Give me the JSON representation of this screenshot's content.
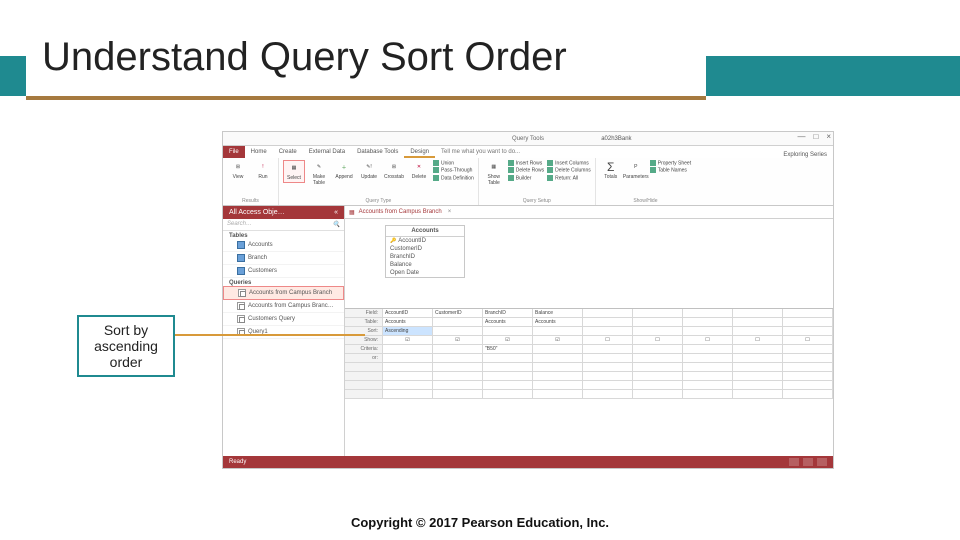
{
  "slide": {
    "title": "Understand Query Sort Order",
    "callout": "Sort by ascending order",
    "copyright": "Copyright © 2017 Pearson Education, Inc."
  },
  "window": {
    "context_label": "Query Tools",
    "filename": "a02h3Bank",
    "signin": "Exploring Series",
    "controls": {
      "min": "—",
      "max": "□",
      "close": "×"
    }
  },
  "ribbon_tabs": [
    "File",
    "Home",
    "Create",
    "External Data",
    "Database Tools",
    "Design",
    "Tell me what you want to do..."
  ],
  "ribbon": {
    "groups": [
      {
        "name": "Results",
        "buttons": [
          "View",
          "Run"
        ]
      },
      {
        "name": "Query Type",
        "buttons": [
          "Select",
          "Make Table",
          "Append",
          "Update",
          "Crosstab",
          "Delete"
        ],
        "extras": [
          "Union",
          "Pass-Through",
          "Data Definition"
        ]
      },
      {
        "name": "Query Setup",
        "buttons": [
          "Show Table"
        ],
        "rows": [
          "Insert Rows",
          "Delete Rows",
          "Builder"
        ],
        "cols": [
          "Insert Columns",
          "Delete Columns",
          "Return: All"
        ]
      },
      {
        "name": "Show/Hide",
        "buttons": [
          "Totals",
          "Parameters"
        ],
        "props": [
          "Property Sheet",
          "Table Names"
        ]
      }
    ]
  },
  "nav": {
    "title": "All Access Obje…",
    "search": "Search…",
    "groups": [
      {
        "label": "Tables",
        "type": "table",
        "items": [
          "Accounts",
          "Branch",
          "Customers"
        ]
      },
      {
        "label": "Queries",
        "type": "query",
        "items": [
          "Accounts from Campus Branch",
          "Accounts from Campus Branc…",
          "Customers Query",
          "Query1"
        ]
      }
    ],
    "selected": "Accounts from Campus Branch"
  },
  "tab_open": "Accounts from Campus Branch",
  "table_box": {
    "name": "Accounts",
    "fields": [
      "AccountID",
      "CustomerID",
      "BranchID",
      "Balance",
      "Open Date"
    ],
    "key": "AccountID"
  },
  "qbe": {
    "row_labels": [
      "Field:",
      "Table:",
      "Sort:",
      "Show:",
      "Criteria:",
      "or:"
    ],
    "columns": [
      {
        "field": "AccountID",
        "table": "Accounts",
        "sort": "Ascending",
        "show": true,
        "criteria": "",
        "or": ""
      },
      {
        "field": "CustomerID",
        "table": "",
        "sort": "",
        "show": true,
        "criteria": "",
        "or": ""
      },
      {
        "field": "BranchID",
        "table": "Accounts",
        "sort": "",
        "show": true,
        "criteria": "\"B50\"",
        "or": ""
      },
      {
        "field": "Balance",
        "table": "Accounts",
        "sort": "",
        "show": true,
        "criteria": "",
        "or": ""
      },
      {
        "field": "",
        "table": "",
        "sort": "",
        "show": false,
        "criteria": "",
        "or": ""
      },
      {
        "field": "",
        "table": "",
        "sort": "",
        "show": false,
        "criteria": "",
        "or": ""
      },
      {
        "field": "",
        "table": "",
        "sort": "",
        "show": false,
        "criteria": "",
        "or": ""
      },
      {
        "field": "",
        "table": "",
        "sort": "",
        "show": false,
        "criteria": "",
        "or": ""
      },
      {
        "field": "",
        "table": "",
        "sort": "",
        "show": false,
        "criteria": "",
        "or": ""
      }
    ]
  },
  "status": {
    "left": "Ready"
  },
  "icons": {
    "view": "⊞",
    "run": "!",
    "select": "▦",
    "make": "✎",
    "append": "＋",
    "update": "✎!",
    "crosstab": "⊞",
    "delete": "✕",
    "totals": "Σ",
    "params": "P",
    "sheet": "▤",
    "tnames": "▭"
  }
}
